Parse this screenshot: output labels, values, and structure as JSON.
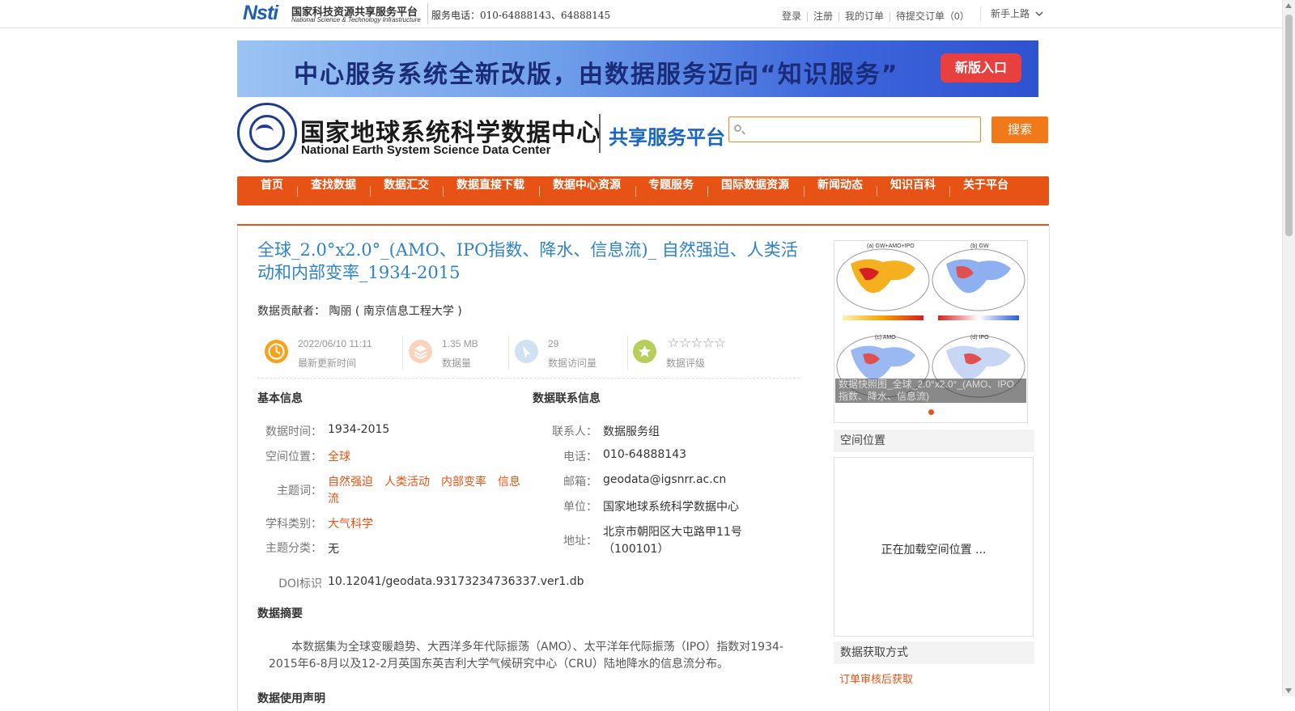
{
  "topbar": {
    "logo_word": "Nsti",
    "logo_cn": "国家科技资源共享服务平台",
    "logo_en": "National Science & Technology Infrastructure",
    "phone": "服务电话：010-64888143、64888145",
    "links": [
      "登录",
      "注册",
      "我的订单",
      "待提交订单（0）"
    ],
    "guide": "新手上路"
  },
  "banner": {
    "text": "中心服务系统全新改版，由数据服务迈向“知识服务”",
    "button": "新版入口"
  },
  "header": {
    "title_cn": "国家地球系统科学数据中心",
    "title_en": "National Earth System Science Data Center",
    "subtitle": "共享服务平台",
    "search_placeholder": "",
    "search_button": "搜索"
  },
  "nav": [
    "首页",
    "查找数据",
    "数据汇交",
    "数据直接下载",
    "数据中心资源",
    "专题服务",
    "国际数据资源",
    "新闻动态",
    "知识百科",
    "关于平台"
  ],
  "dataset": {
    "title": "全球_2.0°x2.0°_(AMO、IPO指数、降水、信息流)_ 自然强迫、人类活动和内部变率_1934-2015",
    "contributor_label": "数据贡献者：",
    "contributor": "陶丽 ( 南京信息工程大学 )",
    "stats": [
      {
        "value": "2022/06/10 11:11",
        "label": "最新更新时间",
        "color": "#f7a21b"
      },
      {
        "value": "1.35 MB",
        "label": "数据量",
        "color": "#fbd3bd"
      },
      {
        "value": "29",
        "label": "数据访问量",
        "color": "#cfe2f3"
      },
      {
        "value": "",
        "label": "数据评级",
        "color": "#b7cf5a"
      }
    ],
    "rating": "☆☆☆☆☆"
  },
  "basic_info": {
    "heading": "基本信息",
    "time_label": "数据时间：",
    "time": "1934-2015",
    "space_label": "空间位置：",
    "space": "全球",
    "keywords_label": "主题词：",
    "keywords_line1": "自然强迫　人类活动　内部变率　信息",
    "keywords_line2": "流",
    "discipline_label": "学科类别：",
    "discipline": "大气科学",
    "category_label": "主题分类：",
    "category": "无",
    "doi_label": "DOI标识",
    "doi": "10.12041/geodata.93173234736337.ver1.db"
  },
  "contact": {
    "heading": "数据联系信息",
    "person_label": "联系人：",
    "person": "数据服务组",
    "phone_label": "电话：",
    "phone": "010-64888143",
    "email_label": "邮箱：",
    "email": "geodata@igsnrr.ac.cn",
    "unit_label": "单位：",
    "unit": "国家地球系统科学数据中心",
    "address_label": "地址：",
    "address_line1": "北京市朝阳区大屯路甲11号",
    "address_line2": "（100101）"
  },
  "abstract": {
    "heading": "数据摘要",
    "text": "本数据集为全球变暖趋势、大西洋多年代际振荡（AMO）、太平洋年代际振荡（IPO）指数对1934-2015年6-8月以及12-2月英国东英吉利大学气候研究中心（CRU）陆地降水的信息流分布。",
    "next_heading": "数据使用声明"
  },
  "sidebar": {
    "thumb_labels": [
      "(a) GW+AMO+IPO",
      "(b) GW",
      "(c) AMO",
      "(d) IPO"
    ],
    "thumb_caption": "数据快照图_全球_2.0°x2.0°_(AMO、IPO指数、降水、信息流)",
    "space_heading": "空间位置",
    "space_loading": "正在加载空间位置 ...",
    "acquire_heading": "数据获取方式",
    "acquire_link": "订单审核后获取"
  }
}
